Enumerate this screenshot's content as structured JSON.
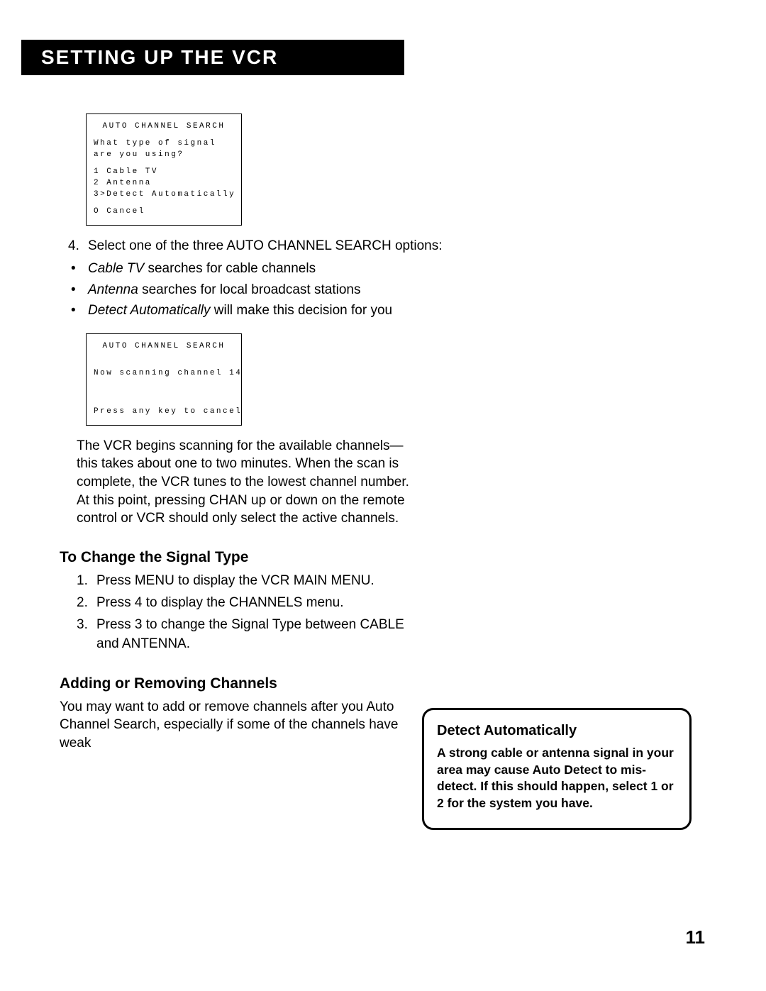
{
  "header": {
    "title": "Setting Up the VCR"
  },
  "osd1": {
    "title": "AUTO CHANNEL SEARCH",
    "q1": "What type of signal",
    "q2": "are you using?",
    "opt1": "1 Cable TV",
    "opt2": "2 Antenna",
    "opt3": "3>Detect Automatically",
    "cancel": "O Cancel"
  },
  "step4": {
    "num": "4.",
    "text": "Select one of the three AUTO CHANNEL SEARCH options:"
  },
  "bullets": {
    "b1_em": "Cable TV",
    "b1_rest": " searches for cable channels",
    "b2_em": "Antenna",
    "b2_rest": " searches for local broadcast stations",
    "b3_em": "Detect Automatically",
    "b3_rest": " will make this decision for you"
  },
  "osd2": {
    "title": "AUTO CHANNEL SEARCH",
    "mid": "Now scanning channel 14",
    "foot": "Press any key to cancel"
  },
  "scan_para": "The VCR begins scanning for the available channels—this takes about one to two minutes. When the scan is complete, the VCR tunes to the lowest channel number. At this point, pressing CHAN up or down on the remote control or VCR should only select the active channels.",
  "sub1": {
    "title": "To  Change the Signal Type",
    "s1n": "1.",
    "s1": "Press MENU to display the VCR MAIN MENU.",
    "s2n": "2.",
    "s2": "Press 4 to display the CHANNELS menu.",
    "s3n": "3.",
    "s3": "Press 3 to change the Signal Type between CABLE and ANTENNA."
  },
  "sub2": {
    "title": "Adding or Removing Channels",
    "para": "You may want to add or remove channels after you Auto Channel Search, especially if some of the channels have weak"
  },
  "callout": {
    "title": "Detect Automatically",
    "body": "A strong cable or antenna signal in your area may cause Auto Detect to mis-detect. If this should happen, select 1 or 2 for the system you have."
  },
  "page_number": "11"
}
